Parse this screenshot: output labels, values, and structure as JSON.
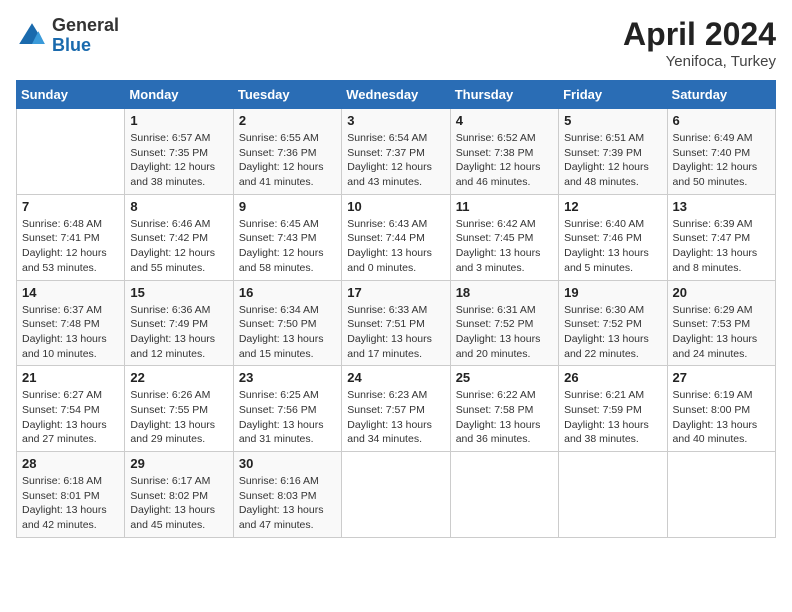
{
  "header": {
    "logo_general": "General",
    "logo_blue": "Blue",
    "month_year": "April 2024",
    "location": "Yenifoca, Turkey"
  },
  "days_of_week": [
    "Sunday",
    "Monday",
    "Tuesday",
    "Wednesday",
    "Thursday",
    "Friday",
    "Saturday"
  ],
  "weeks": [
    [
      {
        "num": "",
        "sunrise": "",
        "sunset": "",
        "daylight": ""
      },
      {
        "num": "1",
        "sunrise": "Sunrise: 6:57 AM",
        "sunset": "Sunset: 7:35 PM",
        "daylight": "Daylight: 12 hours and 38 minutes."
      },
      {
        "num": "2",
        "sunrise": "Sunrise: 6:55 AM",
        "sunset": "Sunset: 7:36 PM",
        "daylight": "Daylight: 12 hours and 41 minutes."
      },
      {
        "num": "3",
        "sunrise": "Sunrise: 6:54 AM",
        "sunset": "Sunset: 7:37 PM",
        "daylight": "Daylight: 12 hours and 43 minutes."
      },
      {
        "num": "4",
        "sunrise": "Sunrise: 6:52 AM",
        "sunset": "Sunset: 7:38 PM",
        "daylight": "Daylight: 12 hours and 46 minutes."
      },
      {
        "num": "5",
        "sunrise": "Sunrise: 6:51 AM",
        "sunset": "Sunset: 7:39 PM",
        "daylight": "Daylight: 12 hours and 48 minutes."
      },
      {
        "num": "6",
        "sunrise": "Sunrise: 6:49 AM",
        "sunset": "Sunset: 7:40 PM",
        "daylight": "Daylight: 12 hours and 50 minutes."
      }
    ],
    [
      {
        "num": "7",
        "sunrise": "Sunrise: 6:48 AM",
        "sunset": "Sunset: 7:41 PM",
        "daylight": "Daylight: 12 hours and 53 minutes."
      },
      {
        "num": "8",
        "sunrise": "Sunrise: 6:46 AM",
        "sunset": "Sunset: 7:42 PM",
        "daylight": "Daylight: 12 hours and 55 minutes."
      },
      {
        "num": "9",
        "sunrise": "Sunrise: 6:45 AM",
        "sunset": "Sunset: 7:43 PM",
        "daylight": "Daylight: 12 hours and 58 minutes."
      },
      {
        "num": "10",
        "sunrise": "Sunrise: 6:43 AM",
        "sunset": "Sunset: 7:44 PM",
        "daylight": "Daylight: 13 hours and 0 minutes."
      },
      {
        "num": "11",
        "sunrise": "Sunrise: 6:42 AM",
        "sunset": "Sunset: 7:45 PM",
        "daylight": "Daylight: 13 hours and 3 minutes."
      },
      {
        "num": "12",
        "sunrise": "Sunrise: 6:40 AM",
        "sunset": "Sunset: 7:46 PM",
        "daylight": "Daylight: 13 hours and 5 minutes."
      },
      {
        "num": "13",
        "sunrise": "Sunrise: 6:39 AM",
        "sunset": "Sunset: 7:47 PM",
        "daylight": "Daylight: 13 hours and 8 minutes."
      }
    ],
    [
      {
        "num": "14",
        "sunrise": "Sunrise: 6:37 AM",
        "sunset": "Sunset: 7:48 PM",
        "daylight": "Daylight: 13 hours and 10 minutes."
      },
      {
        "num": "15",
        "sunrise": "Sunrise: 6:36 AM",
        "sunset": "Sunset: 7:49 PM",
        "daylight": "Daylight: 13 hours and 12 minutes."
      },
      {
        "num": "16",
        "sunrise": "Sunrise: 6:34 AM",
        "sunset": "Sunset: 7:50 PM",
        "daylight": "Daylight: 13 hours and 15 minutes."
      },
      {
        "num": "17",
        "sunrise": "Sunrise: 6:33 AM",
        "sunset": "Sunset: 7:51 PM",
        "daylight": "Daylight: 13 hours and 17 minutes."
      },
      {
        "num": "18",
        "sunrise": "Sunrise: 6:31 AM",
        "sunset": "Sunset: 7:52 PM",
        "daylight": "Daylight: 13 hours and 20 minutes."
      },
      {
        "num": "19",
        "sunrise": "Sunrise: 6:30 AM",
        "sunset": "Sunset: 7:52 PM",
        "daylight": "Daylight: 13 hours and 22 minutes."
      },
      {
        "num": "20",
        "sunrise": "Sunrise: 6:29 AM",
        "sunset": "Sunset: 7:53 PM",
        "daylight": "Daylight: 13 hours and 24 minutes."
      }
    ],
    [
      {
        "num": "21",
        "sunrise": "Sunrise: 6:27 AM",
        "sunset": "Sunset: 7:54 PM",
        "daylight": "Daylight: 13 hours and 27 minutes."
      },
      {
        "num": "22",
        "sunrise": "Sunrise: 6:26 AM",
        "sunset": "Sunset: 7:55 PM",
        "daylight": "Daylight: 13 hours and 29 minutes."
      },
      {
        "num": "23",
        "sunrise": "Sunrise: 6:25 AM",
        "sunset": "Sunset: 7:56 PM",
        "daylight": "Daylight: 13 hours and 31 minutes."
      },
      {
        "num": "24",
        "sunrise": "Sunrise: 6:23 AM",
        "sunset": "Sunset: 7:57 PM",
        "daylight": "Daylight: 13 hours and 34 minutes."
      },
      {
        "num": "25",
        "sunrise": "Sunrise: 6:22 AM",
        "sunset": "Sunset: 7:58 PM",
        "daylight": "Daylight: 13 hours and 36 minutes."
      },
      {
        "num": "26",
        "sunrise": "Sunrise: 6:21 AM",
        "sunset": "Sunset: 7:59 PM",
        "daylight": "Daylight: 13 hours and 38 minutes."
      },
      {
        "num": "27",
        "sunrise": "Sunrise: 6:19 AM",
        "sunset": "Sunset: 8:00 PM",
        "daylight": "Daylight: 13 hours and 40 minutes."
      }
    ],
    [
      {
        "num": "28",
        "sunrise": "Sunrise: 6:18 AM",
        "sunset": "Sunset: 8:01 PM",
        "daylight": "Daylight: 13 hours and 42 minutes."
      },
      {
        "num": "29",
        "sunrise": "Sunrise: 6:17 AM",
        "sunset": "Sunset: 8:02 PM",
        "daylight": "Daylight: 13 hours and 45 minutes."
      },
      {
        "num": "30",
        "sunrise": "Sunrise: 6:16 AM",
        "sunset": "Sunset: 8:03 PM",
        "daylight": "Daylight: 13 hours and 47 minutes."
      },
      {
        "num": "",
        "sunrise": "",
        "sunset": "",
        "daylight": ""
      },
      {
        "num": "",
        "sunrise": "",
        "sunset": "",
        "daylight": ""
      },
      {
        "num": "",
        "sunrise": "",
        "sunset": "",
        "daylight": ""
      },
      {
        "num": "",
        "sunrise": "",
        "sunset": "",
        "daylight": ""
      }
    ]
  ]
}
